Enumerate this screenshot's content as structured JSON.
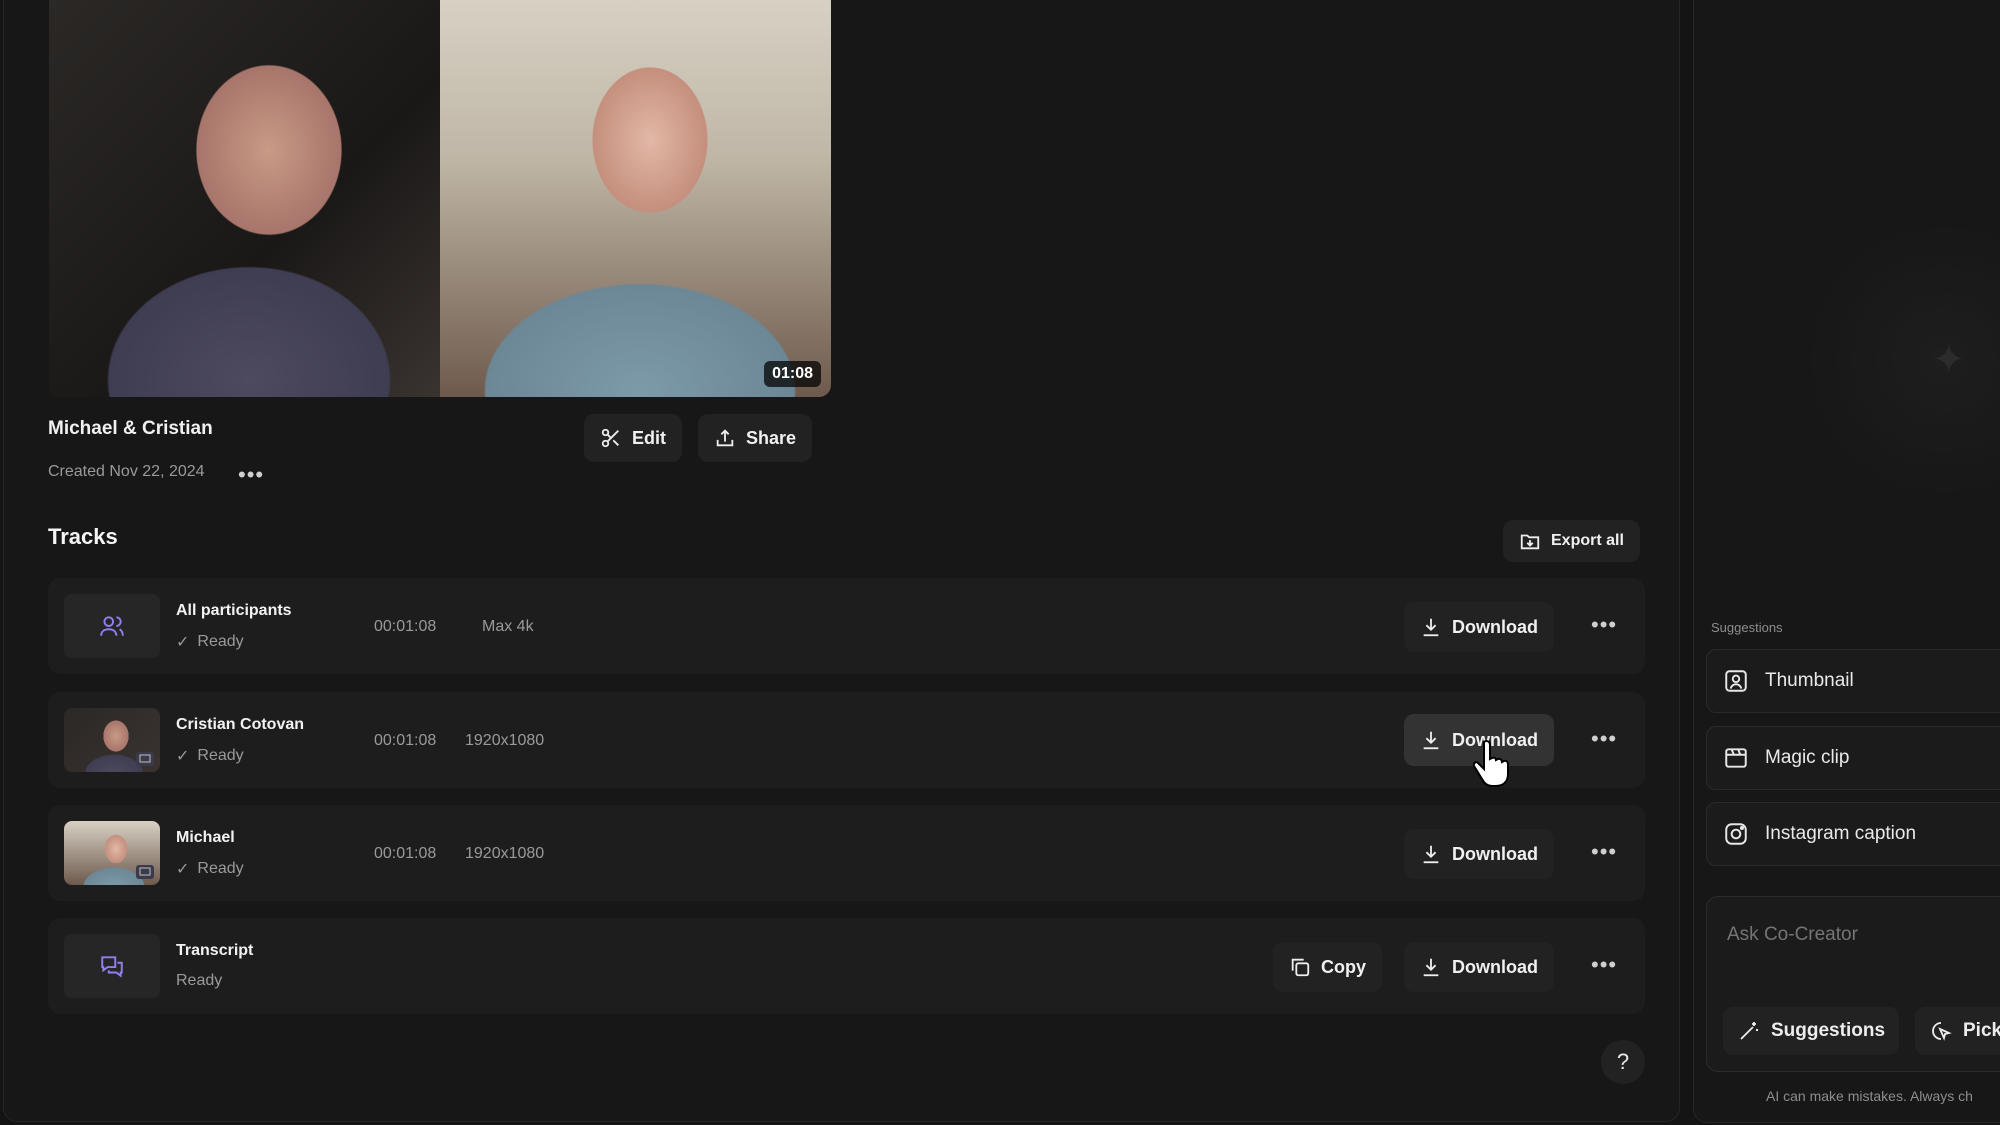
{
  "recording": {
    "duration": "01:08",
    "title": "Michael & Cristian",
    "created": "Created Nov 22, 2024",
    "more": "•••",
    "edit_label": "Edit",
    "share_label": "Share"
  },
  "tracks": {
    "heading": "Tracks",
    "export_all_label": "Export all",
    "download_label": "Download",
    "copy_label": "Copy",
    "more": "•••",
    "items": [
      {
        "name": "All participants",
        "status": "Ready",
        "duration": "00:01:08",
        "resolution": "Max 4k",
        "icon": "users-icon"
      },
      {
        "name": "Cristian Cotovan",
        "status": "Ready",
        "duration": "00:01:08",
        "resolution": "1920x1080",
        "icon": "participant-thumbnail"
      },
      {
        "name": "Michael",
        "status": "Ready",
        "duration": "00:01:08",
        "resolution": "1920x1080",
        "icon": "participant-thumbnail"
      },
      {
        "name": "Transcript",
        "status": "Ready",
        "icon": "chat-bubbles-icon"
      }
    ]
  },
  "side_panel": {
    "suggestions_label": "Suggestions",
    "suggestions": [
      {
        "label": "Thumbnail",
        "icon": "portrait-icon"
      },
      {
        "label": "Magic clip",
        "icon": "clip-icon"
      },
      {
        "label": "Instagram caption",
        "icon": "instagram-icon"
      }
    ],
    "ask_placeholder": "Ask Co-Creator",
    "suggestions_chip": "Suggestions",
    "pick_chip": "Pick",
    "disclaimer": "AI can make mistakes. Always ch"
  },
  "help": "?",
  "colors": {
    "background": "#141414",
    "panel": "#171717",
    "row": "#1d1d1d",
    "accent_icon": "#8f7ff0"
  }
}
